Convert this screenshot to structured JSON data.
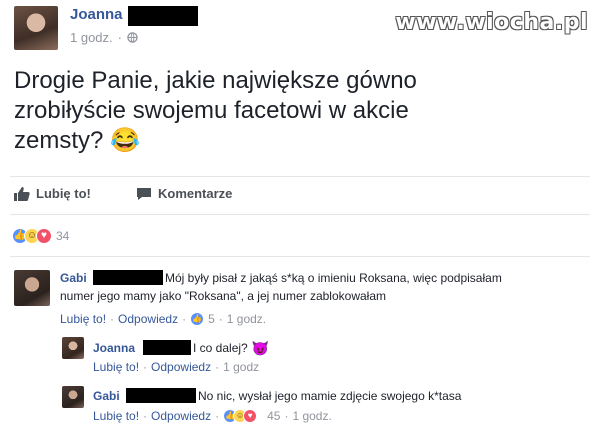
{
  "post": {
    "author": "Joanna",
    "time": "1 godz.",
    "text_line1": "Drogie Panie, jakie największe gówno",
    "text_line2": "zrobiłyście swojemu facetowi w akcie",
    "text_line3": "zemsty?",
    "emoji": "😂"
  },
  "watermark": "www.wiocha.pl",
  "actions": {
    "like": "Lubię to!",
    "comment": "Komentarze"
  },
  "reactions": {
    "count": "34"
  },
  "comments": [
    {
      "author": "Gabi",
      "text_line1": "Mój były pisał z jakąś s*ką o imieniu Roksana, więc podpisałam",
      "text_line2": "numer jego mamy jako \"Roksana\", a jej numer zablokowałam",
      "like": "Lubię to!",
      "reply": "Odpowiedz",
      "likes": "5",
      "time": "1 godz."
    },
    {
      "author": "Joanna",
      "text": "I co dalej?",
      "emoji": "😈",
      "like": "Lubię to!",
      "reply": "Odpowiedz",
      "time": "1 godz"
    },
    {
      "author": "Gabi",
      "text": "No nic, wysłał jego mamie zdjęcie swojego k*tasa",
      "like": "Lubię to!",
      "reply": "Odpowiedz",
      "likes": "45",
      "time": "1 godz."
    }
  ],
  "colors": {
    "link": "#365899",
    "meta": "#90949c",
    "text": "#1d2129",
    "like_blue": "#5890ff",
    "love_red": "#f25268",
    "haha_yellow": "#fcd553"
  },
  "icons": [
    "like-icon",
    "comment-icon",
    "globe-icon",
    "like-reaction-icon",
    "haha-reaction-icon",
    "love-reaction-icon",
    "devil-emoji-icon"
  ]
}
